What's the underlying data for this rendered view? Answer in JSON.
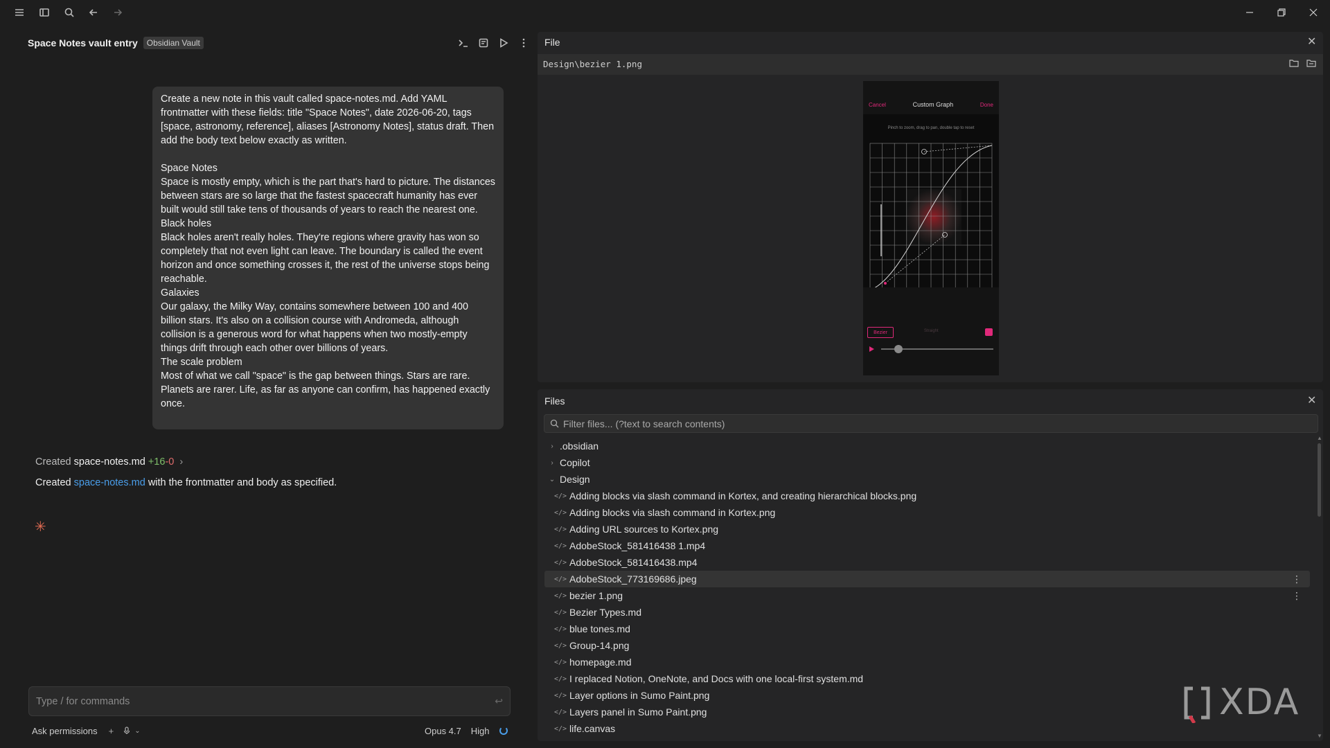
{
  "titlebar": {
    "icons": [
      "menu-icon",
      "sidebar-icon",
      "search-icon",
      "back-icon",
      "forward-icon"
    ],
    "window_controls": [
      "minimize-icon",
      "restore-icon",
      "close-icon"
    ]
  },
  "chat": {
    "title": "Space Notes vault entry",
    "badge": "Obsidian Vault",
    "tools": [
      "terminal-icon",
      "new-chat-icon",
      "run-icon",
      "more-icon"
    ],
    "user_message": "Create a new note in this vault called space-notes.md. Add YAML frontmatter with these fields: title \"Space Notes\", date 2026-06-20, tags [space, astronomy, reference], aliases [Astronomy Notes], status draft. Then add the body text below exactly as written.\n\nSpace Notes\nSpace is mostly empty, which is the part that's hard to picture. The distances between stars are so large that the fastest spacecraft humanity has ever built would still take tens of thousands of years to reach the nearest one.\nBlack holes\nBlack holes aren't really holes. They're regions where gravity has won so completely that not even light can leave. The boundary is called the event horizon and once something crosses it, the rest of the universe stops being reachable.\nGalaxies\nOur galaxy, the Milky Way, contains somewhere between 100 and 400 billion stars. It's also on a collision course with Andromeda, although collision is a generous word for what happens when two mostly-empty things drift through each other over billions of years.\nThe scale problem\nMost of what we call \"space\" is the gap between things. Stars are rare. Planets are rarer. Life, as far as anyone can confirm, has happened exactly once.",
    "created": {
      "prefix": "Created",
      "file": "space-notes.md",
      "added": "+16",
      "removed": "-0",
      "chevron": "›"
    },
    "result": {
      "prefix": "Created",
      "link": "space-notes.md",
      "suffix": "with the frontmatter and body as specified."
    },
    "spark": "✳",
    "input": {
      "placeholder": "Type / for commands",
      "enter_glyph": "↩"
    },
    "footer": {
      "permissions": "Ask permissions",
      "add": "+",
      "mic": "⌕",
      "caret": "⌄",
      "model": "Opus 4.7",
      "effort": "High"
    }
  },
  "file_pane": {
    "title": "File",
    "close": "✕",
    "path": "Design\\bezier 1.png",
    "preview": {
      "cancel": "Cancel",
      "title": "Custom Graph",
      "done": "Done",
      "hint": "Pinch to zoom, drag to pan, double tap to reset",
      "mode": "Bezier",
      "mode2": "Straight"
    }
  },
  "files_pane": {
    "title": "Files",
    "close": "✕",
    "filter_placeholder": "Filter files... (?text to search contents)",
    "folders": [
      {
        "name": ".obsidian",
        "arrow": "›"
      },
      {
        "name": "Copilot",
        "arrow": "›"
      },
      {
        "name": "Design",
        "arrow": "⌄"
      }
    ],
    "file_glyph": "</>",
    "files": [
      "Adding blocks via slash command in Kortex, and creating hierarchical blocks.png",
      "Adding blocks via slash command in Kortex.png",
      "Adding URL sources to Kortex.png",
      "AdobeStock_581416438 1.mp4",
      "AdobeStock_581416438.mp4",
      "AdobeStock_773169686.jpeg",
      "bezier 1.png",
      "Bezier Types.md",
      "blue tones.md",
      "Group-14.png",
      "homepage.md",
      "I replaced Notion, OneNote, and Docs with one local-first system.md",
      "Layer options in Sumo Paint.png",
      "Layers panel in Sumo Paint.png",
      "life.canvas"
    ],
    "selected_index": 5,
    "row_menu": "⋮"
  },
  "watermark": {
    "text": "XDA"
  },
  "colors": {
    "background": "#1e1e1e",
    "pane": "#252526",
    "accent_link": "#4a9eea",
    "added": "#7fbf6a",
    "removed": "#e06c6c",
    "magenta": "#e0297a",
    "spark": "#e06b52"
  }
}
